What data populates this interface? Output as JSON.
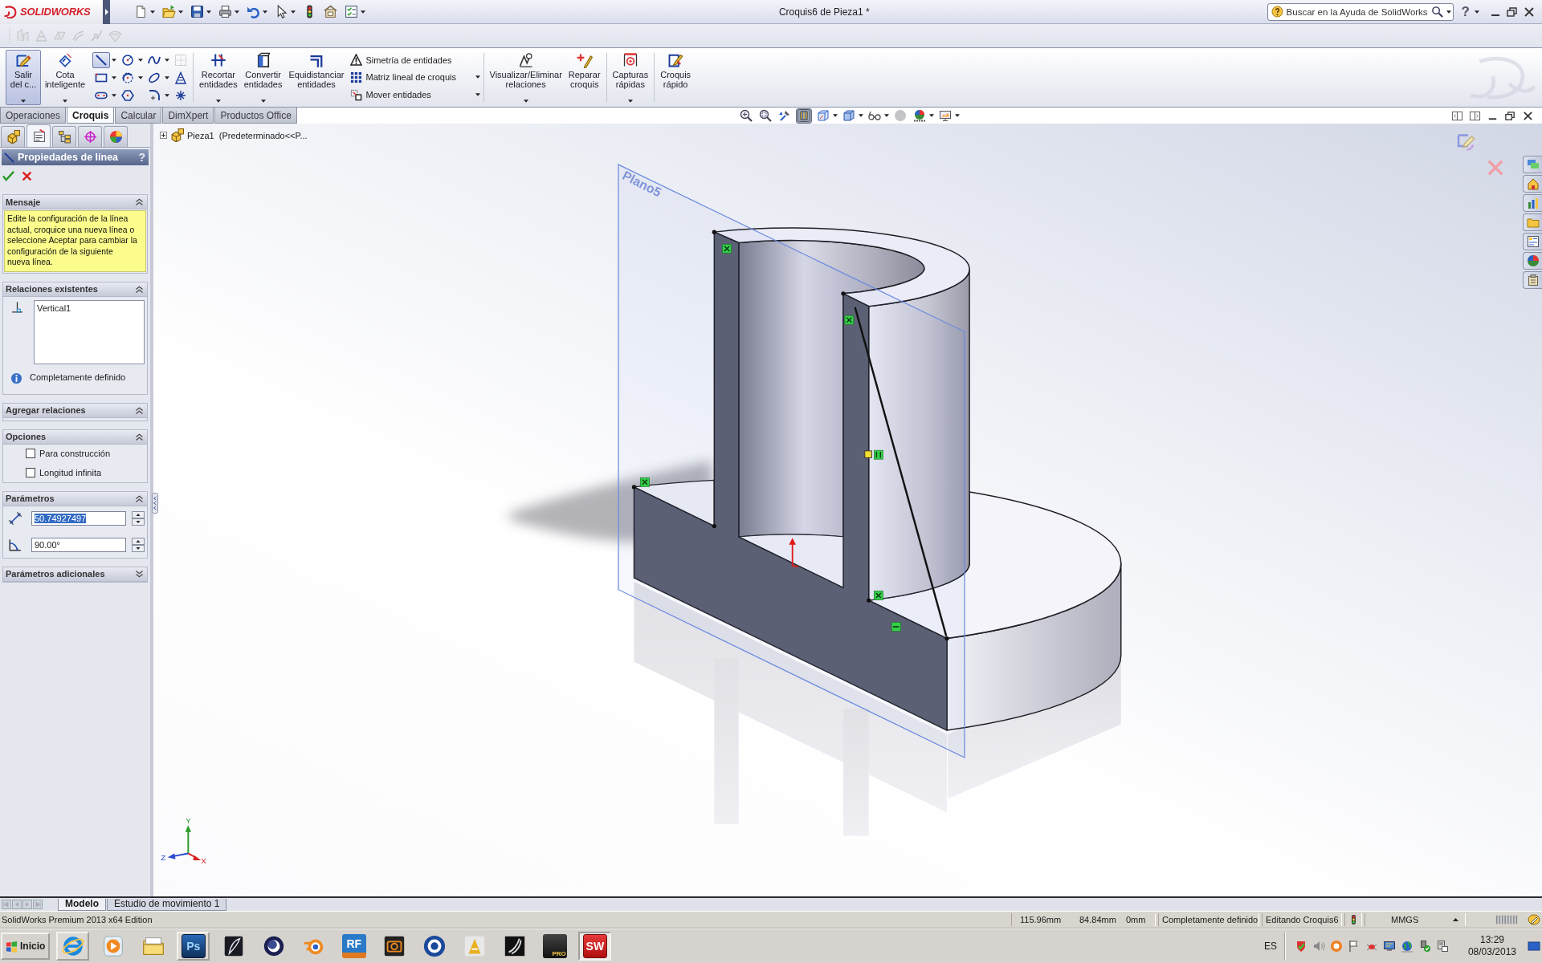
{
  "title_bar": {
    "logo": "SOLIDWORKS",
    "title": "Croquis6 de Pieza1 *",
    "search": {
      "placeholder": "Buscar en la Ayuda de SolidWorks"
    },
    "help": "?"
  },
  "secondary_toolbar": {
    "disabled": true
  },
  "command_manager": {
    "exit_sketch": {
      "label": "Salir\ndel c...",
      "selected": true
    },
    "smart_dimension": {
      "label": "Cota\ninteligente",
      "selected": false
    },
    "sketch_tools": [
      {
        "selected": true
      },
      {
        "selected": false
      },
      {
        "selected": false
      },
      {
        "selected": false
      },
      {
        "selected": false
      },
      {
        "selected": false
      },
      {
        "selected": false
      },
      {
        "selected": false
      },
      {
        "selected": false
      },
      {
        "selected": false
      },
      {
        "selected": false
      },
      {
        "selected": false
      }
    ],
    "tools": [
      {
        "label": "Recortar\nentidades"
      },
      {
        "label": "Convertir\nentidades"
      },
      {
        "label": "Equidistanciar\nentidades"
      }
    ],
    "entity_list": [
      {
        "label": "Simetría de entidades"
      },
      {
        "label": "Matriz lineal de croquis"
      },
      {
        "label": "Mover entidades"
      }
    ],
    "relations": [
      {
        "label": "Visualizar/Eliminar\nrelaciones"
      },
      {
        "label": "Reparar\ncroquis"
      },
      {
        "label": "Capturas\nrápidas"
      },
      {
        "label": "Croquis\nrápido"
      }
    ]
  },
  "tabs": [
    {
      "label": "Operaciones",
      "selected": false
    },
    {
      "label": "Croquis",
      "selected": true
    },
    {
      "label": "Calcular",
      "selected": false
    },
    {
      "label": "DimXpert",
      "selected": false
    },
    {
      "label": "Productos Office",
      "selected": false
    }
  ],
  "panel": {
    "tabs": [
      {
        "selected": false
      },
      {
        "selected": true
      },
      {
        "selected": false
      },
      {
        "selected": false
      },
      {
        "selected": false
      }
    ],
    "title": "Propiedades de línea",
    "help": "?",
    "sections": [
      {
        "kind": "message",
        "title": "Mensaje",
        "expanded": true,
        "text": "Edite la configuración de la línea actual, croquice una nueva línea o seleccione Aceptar para cambiar la configuración de la siguiente nueva línea."
      },
      {
        "kind": "relations",
        "title": "Relaciones existentes",
        "expanded": true,
        "items": [
          {
            "label": "Vertical1",
            "selected": false
          }
        ],
        "status": "Completamente definido"
      },
      {
        "kind": "empty",
        "title": "Agregar relaciones",
        "expanded": true
      },
      {
        "kind": "options",
        "title": "Opciones",
        "expanded": true,
        "options": [
          {
            "label": "Para construcción",
            "checked": false
          },
          {
            "label": "Longitud infinita",
            "checked": false
          }
        ]
      },
      {
        "kind": "parameters",
        "title": "Parámetros",
        "expanded": true,
        "fields": [
          {
            "value": "50.74927497",
            "selected": true
          },
          {
            "value": "90.00°",
            "selected": false
          }
        ]
      },
      {
        "title": "Parámetros adicionales",
        "expanded": false
      }
    ]
  },
  "feature_tree": {
    "label": "Pieza1  (Predeterminado<<P...",
    "expanded": false
  },
  "viewport": {
    "view_tools": [
      {
        "selected": false
      },
      {
        "selected": false
      },
      {
        "selected": false
      },
      {
        "selected": true
      },
      {
        "selected": false
      },
      {
        "selected": false
      },
      {
        "selected": false
      },
      {
        "selected": false
      },
      {
        "selected": false
      },
      {
        "selected": false
      }
    ],
    "plane_label": "Plano5",
    "triad": {
      "x": "X",
      "y": "Y",
      "z": "Z"
    }
  },
  "model_tabs": [
    {
      "label": "Modelo",
      "selected": true
    },
    {
      "label": "Estudio de movimiento 1",
      "selected": false
    }
  ],
  "status_bar": {
    "product": "SolidWorks Premium 2013 x64 Edition",
    "x": "115.96mm",
    "y": "84.84mm",
    "z": "0mm",
    "sketch_state": "Completamente definido",
    "mode": "Editando Croquis6",
    "units": "MMGS"
  },
  "taskbar": {
    "start": "Inicio",
    "apps": [
      {
        "running": true,
        "selected": false
      },
      {
        "running": false,
        "selected": false
      },
      {
        "running": false,
        "selected": false
      },
      {
        "running": true,
        "selected": false,
        "glyph": "Ps"
      },
      {
        "running": false,
        "selected": false
      },
      {
        "running": false,
        "selected": false
      },
      {
        "running": false,
        "selected": false
      },
      {
        "running": false,
        "selected": false,
        "glyph": "RF"
      },
      {
        "running": false,
        "selected": false
      },
      {
        "running": false,
        "selected": false
      },
      {
        "running": false,
        "selected": false
      },
      {
        "running": false,
        "selected": false
      },
      {
        "running": false,
        "selected": false,
        "glyph": "PRO"
      },
      {
        "running": true,
        "selected": true,
        "glyph": "SW"
      }
    ],
    "language": "ES",
    "time": "13:29",
    "date": "08/03/2013"
  }
}
